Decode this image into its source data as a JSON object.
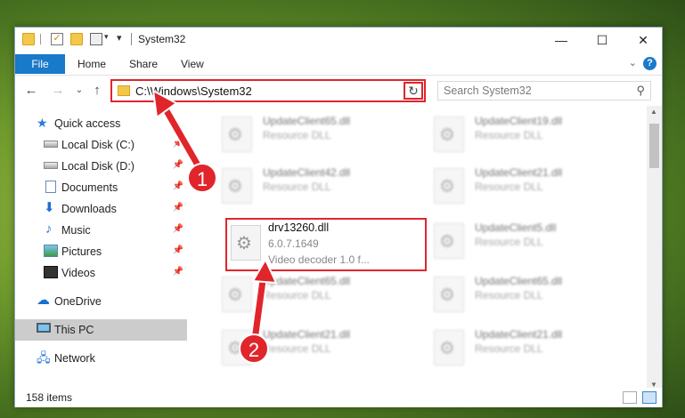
{
  "window": {
    "title": "System32",
    "controls": {
      "minimize": "—",
      "maximize": "☐",
      "close": "✕"
    }
  },
  "ribbon": {
    "tabs": [
      "File",
      "Home",
      "Share",
      "View"
    ],
    "help": "?"
  },
  "nav": {
    "address": "C:\\Windows\\System32",
    "search_placeholder": "Search System32"
  },
  "sidebar": {
    "items": [
      {
        "label": "Quick access",
        "icon": "star-icon"
      },
      {
        "label": "Local Disk (C:)",
        "icon": "disk-icon",
        "pinned": true
      },
      {
        "label": "Local Disk (D:)",
        "icon": "disk-icon",
        "pinned": true
      },
      {
        "label": "Documents",
        "icon": "documents-icon",
        "pinned": true
      },
      {
        "label": "Downloads",
        "icon": "downloads-icon",
        "pinned": true
      },
      {
        "label": "Music",
        "icon": "music-icon",
        "pinned": true
      },
      {
        "label": "Pictures",
        "icon": "pictures-icon",
        "pinned": true
      },
      {
        "label": "Videos",
        "icon": "videos-icon",
        "pinned": true
      },
      {
        "label": "OneDrive",
        "icon": "onedrive-icon"
      },
      {
        "label": "This PC",
        "icon": "this-pc-icon",
        "selected": true
      },
      {
        "label": "Network",
        "icon": "network-icon"
      }
    ]
  },
  "files": [
    {
      "name": "UpdateClient65.dll",
      "desc": "Resource DLL"
    },
    {
      "name": "UpdateClient19.dll",
      "desc": "Resource DLL"
    },
    {
      "name": "UpdateClient42.dll",
      "desc": "Resource DLL"
    },
    {
      "name": "UpdateClient21.dll",
      "desc": "Resource DLL"
    },
    {
      "name": "drv13260.dll",
      "version": "6.0.7.1649",
      "desc": "Video decoder 1.0 f..."
    },
    {
      "name": "UpdateClient5.dll",
      "desc": "Resource DLL"
    },
    {
      "name": "UpdateClient65.dll",
      "desc": "Resource DLL"
    },
    {
      "name": "UpdateClient65.dll",
      "desc": "Resource DLL"
    },
    {
      "name": "UpdateClient21.dll",
      "desc": "Resource DLL"
    },
    {
      "name": "UpdateClient21.dll",
      "desc": "Resource DLL"
    }
  ],
  "status": {
    "items": "158 items"
  },
  "annotations": {
    "step1": "1",
    "step2": "2",
    "color": "#e0252b"
  }
}
